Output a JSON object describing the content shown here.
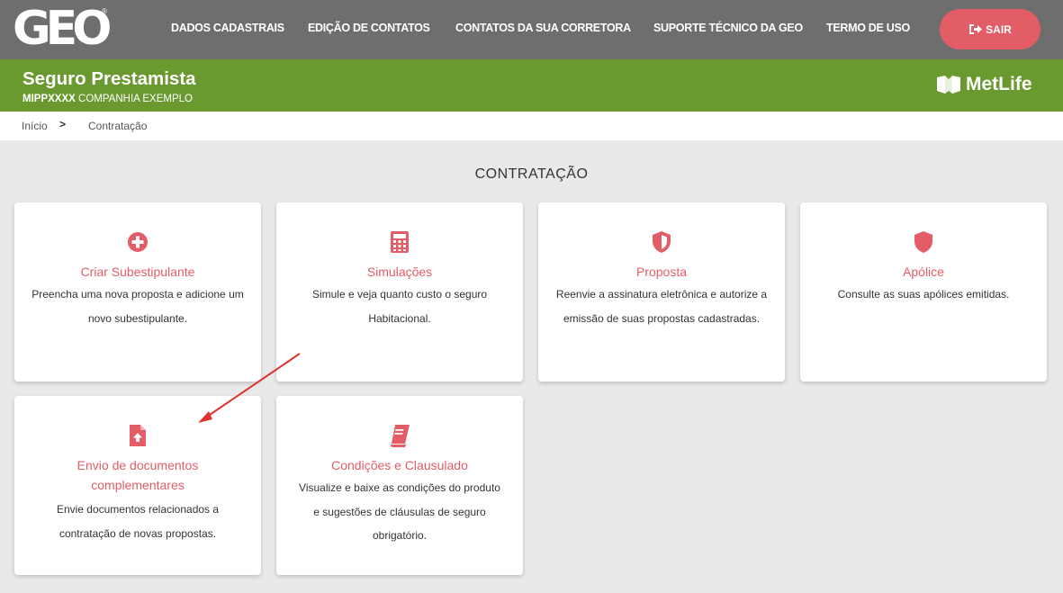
{
  "logo": {
    "text": "GEO",
    "reg": "®"
  },
  "nav": {
    "items": [
      "DADOS CADASTRAIS",
      "EDIÇÃO DE CONTATOS",
      "CONTATOS DA SUA CORRETORA",
      "SUPORTE TÉCNICO DA GEO",
      "TERMO DE USO"
    ],
    "logout_label": "SAIR"
  },
  "header": {
    "title": "Seguro Prestamista",
    "code": "MIPPXXXX",
    "company": "COMPANHIA EXEMPLO",
    "brand": "MetLife"
  },
  "breadcrumb": {
    "home": "Início",
    "current": "Contratação"
  },
  "section_title": "CONTRATAÇÃO",
  "cards": [
    {
      "title": "Criar Subestipulante",
      "desc": "Preencha uma nova proposta e adicione um novo subestipulante.",
      "icon": "plus-circle-icon"
    },
    {
      "title": "Simulações",
      "desc": "Simule e veja quanto custo o seguro Habitacional.",
      "icon": "calculator-icon"
    },
    {
      "title": "Proposta",
      "desc": "Reenvie a assinatura eletrônica e autorize a emissão de suas propostas cadastradas.",
      "icon": "shield-half-icon"
    },
    {
      "title": "Apólice",
      "desc": "Consulte as suas apólices emitidas.",
      "icon": "shield-icon"
    },
    {
      "title": "Envio de documentos complementares",
      "desc": "Envie documentos relacionados a contratação de novas propostas.",
      "icon": "file-upload-icon"
    },
    {
      "title": "Condições e Clausulado",
      "desc": "Visualize e baixe as condições do produto e sugestões de cláusulas de seguro obrigatório.",
      "icon": "book-icon"
    }
  ],
  "colors": {
    "accent": "#e35d66",
    "nav_bg": "#6e6e6e",
    "header_green": "#6a9a2f",
    "page_bg": "#e9e9e9",
    "annotation_arrow": "#e0332e"
  }
}
